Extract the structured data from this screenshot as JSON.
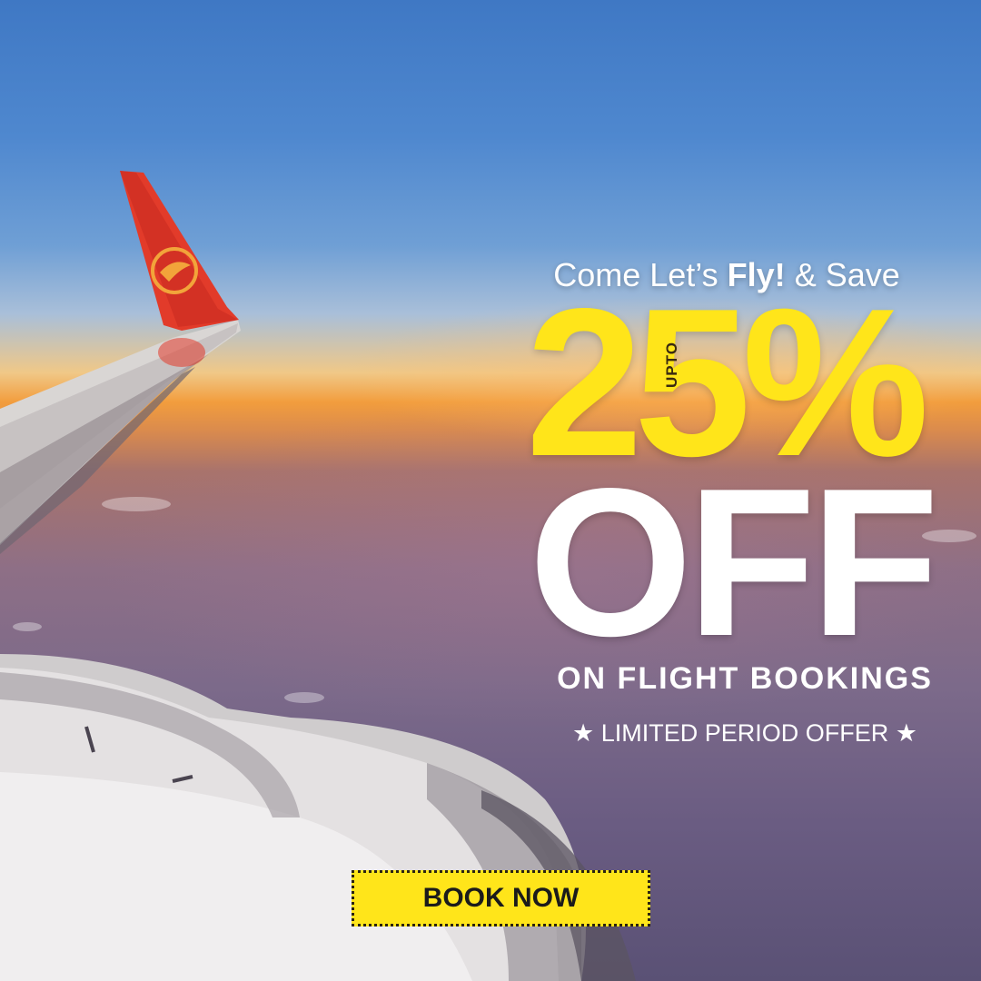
{
  "headline": {
    "prefix": "Come Let’s ",
    "bold": "Fly!",
    "suffix": "  & Save"
  },
  "offer": {
    "upto": "UPTO",
    "amount": "25%",
    "off": "OFF"
  },
  "subline": "ON FLIGHT BOOKINGS",
  "tagline": "★ LIMITED PERIOD OFFER ★",
  "cta": {
    "label": "BOOK NOW"
  },
  "colors": {
    "accent": "#ffe51a",
    "text": "#ffffff",
    "wing_tip": "#e23b2a"
  }
}
